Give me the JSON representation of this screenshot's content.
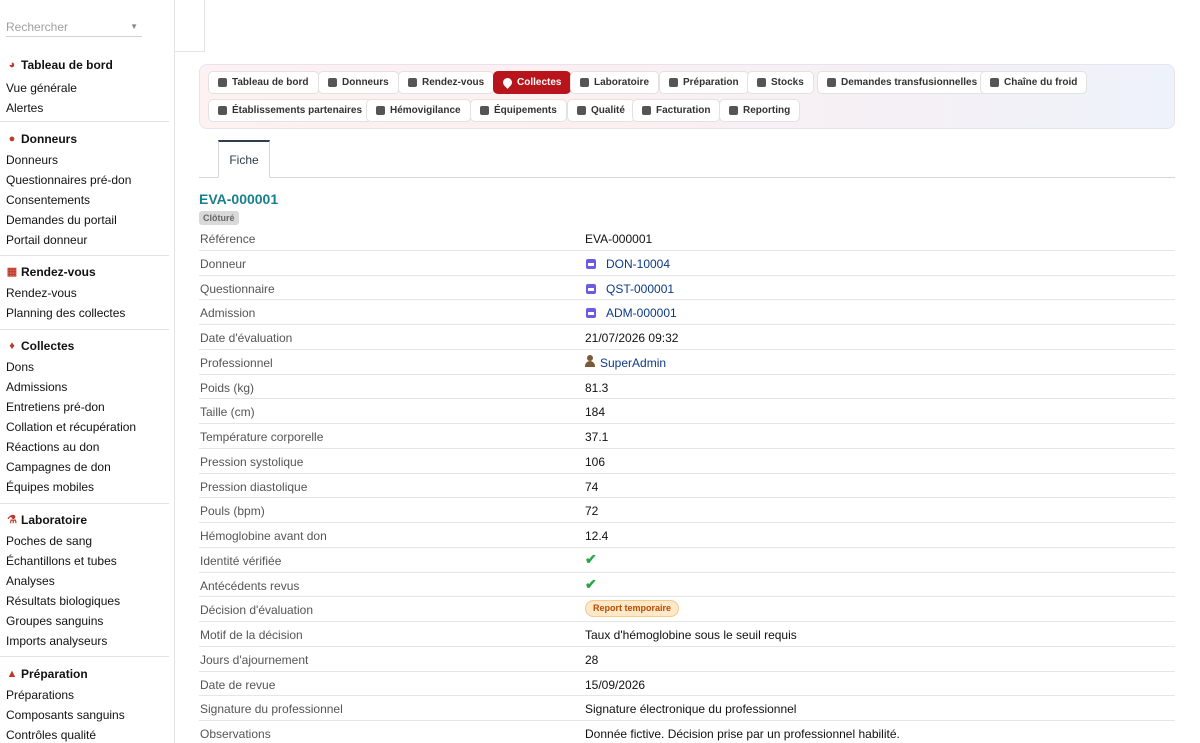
{
  "sidebar": {
    "search_placeholder": "Rechercher",
    "sections": [
      {
        "title": "Tableau de bord",
        "icon": "gauge-icon",
        "items": [
          "Vue générale",
          "Alertes"
        ]
      },
      {
        "title": "Donneurs",
        "icon": "user-icon",
        "items": [
          "Donneurs",
          "Questionnaires pré-don",
          "Consentements",
          "Demandes du portail",
          "Portail donneur"
        ]
      },
      {
        "title": "Rendez-vous",
        "icon": "calendar-icon",
        "items": [
          "Rendez-vous",
          "Planning des collectes"
        ]
      },
      {
        "title": "Collectes",
        "icon": "blood-drop-icon",
        "items": [
          "Dons",
          "Admissions",
          "Entretiens pré-don",
          "Collation et récupération",
          "Réactions au don",
          "Campagnes de don",
          "Équipes mobiles"
        ]
      },
      {
        "title": "Laboratoire",
        "icon": "microscope-icon",
        "items": [
          "Poches de sang",
          "Échantillons et tubes",
          "Analyses",
          "Résultats biologiques",
          "Groupes sanguins",
          "Imports analyseurs"
        ]
      },
      {
        "title": "Préparation",
        "icon": "flask-icon",
        "items": [
          "Préparations",
          "Composants sanguins",
          "Contrôles qualité"
        ]
      }
    ]
  },
  "modnav": {
    "row1": [
      "Tableau de bord",
      "Donneurs",
      "Rendez-vous",
      "Collectes",
      "Laboratoire",
      "Préparation",
      "Stocks",
      "Demandes transfusionnelles",
      "Chaîne du froid"
    ],
    "row2": [
      "Établissements partenaires",
      "Hémovigilance",
      "Équipements",
      "Qualité",
      "Facturation",
      "Reporting"
    ],
    "active": "Collectes"
  },
  "tabs": {
    "fiche": "Fiche"
  },
  "record": {
    "title": "EVA-000001",
    "status": "Clôturé",
    "fields": {
      "reference": {
        "label": "Référence",
        "value": "EVA-000001"
      },
      "donneur": {
        "label": "Donneur",
        "value": "DON-10004"
      },
      "questionnaire": {
        "label": "Questionnaire",
        "value": "QST-000001"
      },
      "admission": {
        "label": "Admission",
        "value": "ADM-000001"
      },
      "date_eval": {
        "label": "Date d'évaluation",
        "value": "21/07/2026 09:32"
      },
      "professionnel": {
        "label": "Professionnel",
        "value": "SuperAdmin"
      },
      "poids": {
        "label": "Poids (kg)",
        "value": "81.3"
      },
      "taille": {
        "label": "Taille (cm)",
        "value": "184"
      },
      "temperature": {
        "label": "Température corporelle",
        "value": "37.1"
      },
      "systolique": {
        "label": "Pression systolique",
        "value": "106"
      },
      "diastolique": {
        "label": "Pression diastolique",
        "value": "74"
      },
      "pouls": {
        "label": "Pouls (bpm)",
        "value": "72"
      },
      "hemoglobine": {
        "label": "Hémoglobine avant don",
        "value": "12.4"
      },
      "identite": {
        "label": "Identité vérifiée",
        "value": true
      },
      "antecedents": {
        "label": "Antécédents revus",
        "value": true
      },
      "decision": {
        "label": "Décision d'évaluation",
        "value": "Report temporaire"
      },
      "motif": {
        "label": "Motif de la décision",
        "value": "Taux d'hémoglobine sous le seuil requis"
      },
      "jours": {
        "label": "Jours d'ajournement",
        "value": "28"
      },
      "date_revue": {
        "label": "Date de revue",
        "value": "15/09/2026"
      },
      "signature": {
        "label": "Signature du professionnel",
        "value": "Signature électronique du professionnel"
      },
      "observations": {
        "label": "Observations",
        "value": "Donnée fictive. Décision prise par un professionnel habilité."
      }
    }
  },
  "colors": {
    "accent": "#b8141b",
    "title": "#1a7f8c",
    "link": "#0b3a88",
    "check": "#28a745"
  }
}
